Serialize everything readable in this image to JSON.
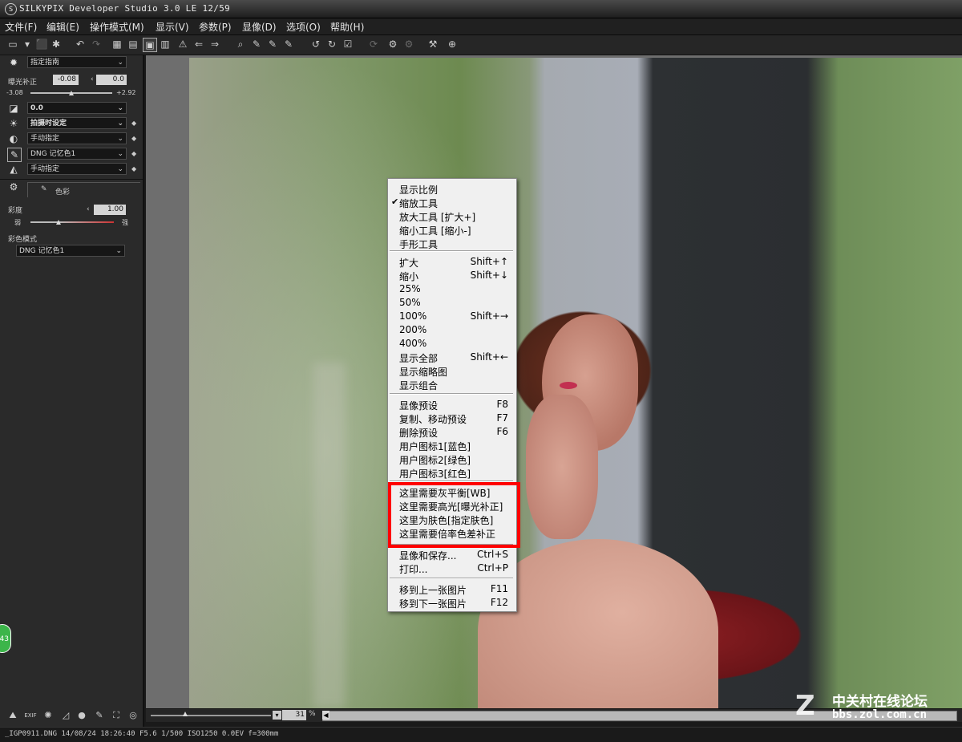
{
  "window": {
    "title": "SILKYPIX Developer Studio 3.0 LE   12/59"
  },
  "menu": [
    "文件(F)",
    "编辑(E)",
    "操作模式(M)",
    "显示(V)",
    "参数(P)",
    "显像(D)",
    "选项(O)",
    "帮助(H)"
  ],
  "toolbar": {
    "icons": [
      "open-icon",
      "open-dropdown-icon",
      "save-icon",
      "wand-icon",
      "undo-icon",
      "redo-icon",
      "grid-view-icon",
      "filmstrip-view-icon",
      "single-view-icon",
      "compare-view-icon",
      "warning-icon",
      "move-left-icon",
      "move-right-icon",
      "zoom-icon",
      "eyedropper-wb-icon",
      "eyedropper-highlight-icon",
      "eyedropper-skin-icon",
      "rotate-left-icon",
      "rotate-right-icon",
      "check-icon",
      "refresh-icon",
      "develop-icon",
      "batch-icon",
      "hammer-icon",
      "help-icon"
    ],
    "glyphs": [
      "▭",
      "▾",
      "⬛",
      "✱",
      "↶",
      "↷",
      "▦",
      "▤",
      "▣",
      "▥",
      "⚠",
      "⇐",
      "⇒",
      "⌕",
      "✎",
      "✎",
      "✎",
      "↺",
      "↻",
      "☑",
      "⟳",
      "⚙",
      "⚙",
      "⚒",
      "⊕"
    ]
  },
  "sidebar": {
    "preset": "指定指南",
    "exposure": {
      "label": "曝光补正",
      "value": "-0.08",
      "value2": "0.0",
      "min": "-3.08",
      "max": "+2.92",
      "level": 0.5
    },
    "tone": "0.0",
    "wb": "拍摄时设定",
    "contrast": "手动指定",
    "color": "DNG 记忆色1",
    "sharpness": "手动指定",
    "tab_label": "色彩",
    "saturation": {
      "label": "彩度",
      "value": "1.00",
      "left": "弱",
      "right": "强",
      "level": 0.33
    },
    "color_mode_label": "彩色模式",
    "color_mode": "DNG 记忆色1"
  },
  "zoom": {
    "value": "31",
    "unit": "%",
    "level": 0.3
  },
  "status": "_IGP0911.DNG 14/08/24 18:26:40 F5.6 1/500 ISO1250 0.0EV f=300mm",
  "badge": "43",
  "watermark": {
    "logo": "Z",
    "line1": "中关村在线论坛",
    "line2": "bbs.zol.com.cn"
  },
  "context_menu": {
    "group1": [
      {
        "label": "显示比例",
        "checked": false
      },
      {
        "label": "缩放工具",
        "checked": true
      },
      {
        "label": "放大工具 [扩大+]",
        "checked": false
      },
      {
        "label": "缩小工具 [缩小-]",
        "checked": false
      },
      {
        "label": "手形工具",
        "checked": false
      }
    ],
    "group2": [
      {
        "label": "扩大",
        "key": "Shift+↑"
      },
      {
        "label": "缩小",
        "key": "Shift+↓"
      },
      {
        "label": "25%",
        "key": ""
      },
      {
        "label": "50%",
        "key": ""
      },
      {
        "label": "100%",
        "key": "Shift+→"
      },
      {
        "label": "200%",
        "key": ""
      },
      {
        "label": "400%",
        "key": ""
      },
      {
        "label": "显示全部",
        "key": "Shift+←"
      },
      {
        "label": "显示缩略图",
        "key": ""
      },
      {
        "label": "显示组合",
        "key": ""
      }
    ],
    "group3": [
      {
        "label": "显像预设",
        "key": "F8"
      },
      {
        "label": "复制、移动预设",
        "key": "F7"
      },
      {
        "label": "删除预设",
        "key": "F6"
      },
      {
        "label": "用户图标1[蓝色]",
        "key": ""
      },
      {
        "label": "用户图标2[绿色]",
        "key": ""
      },
      {
        "label": "用户图标3[红色]",
        "key": ""
      }
    ],
    "group4": [
      {
        "label": "这里需要灰平衡[WB]",
        "key": ""
      },
      {
        "label": "这里需要高光[曝光补正]",
        "key": ""
      },
      {
        "label": "这里为肤色[指定肤色]",
        "key": ""
      },
      {
        "label": "这里需要倍率色差补正",
        "key": ""
      }
    ],
    "group5": [
      {
        "label": "显像和保存...",
        "key": "Ctrl+S"
      },
      {
        "label": "打印...",
        "key": "Ctrl+P"
      }
    ],
    "group6": [
      {
        "label": "移到上一张图片",
        "key": "F11"
      },
      {
        "label": "移到下一张图片",
        "key": "F12"
      }
    ]
  },
  "colors": {
    "highlight": "#ff0000",
    "menu_bg": "#f0f0f0",
    "app_bg": "#2a2a2a"
  }
}
